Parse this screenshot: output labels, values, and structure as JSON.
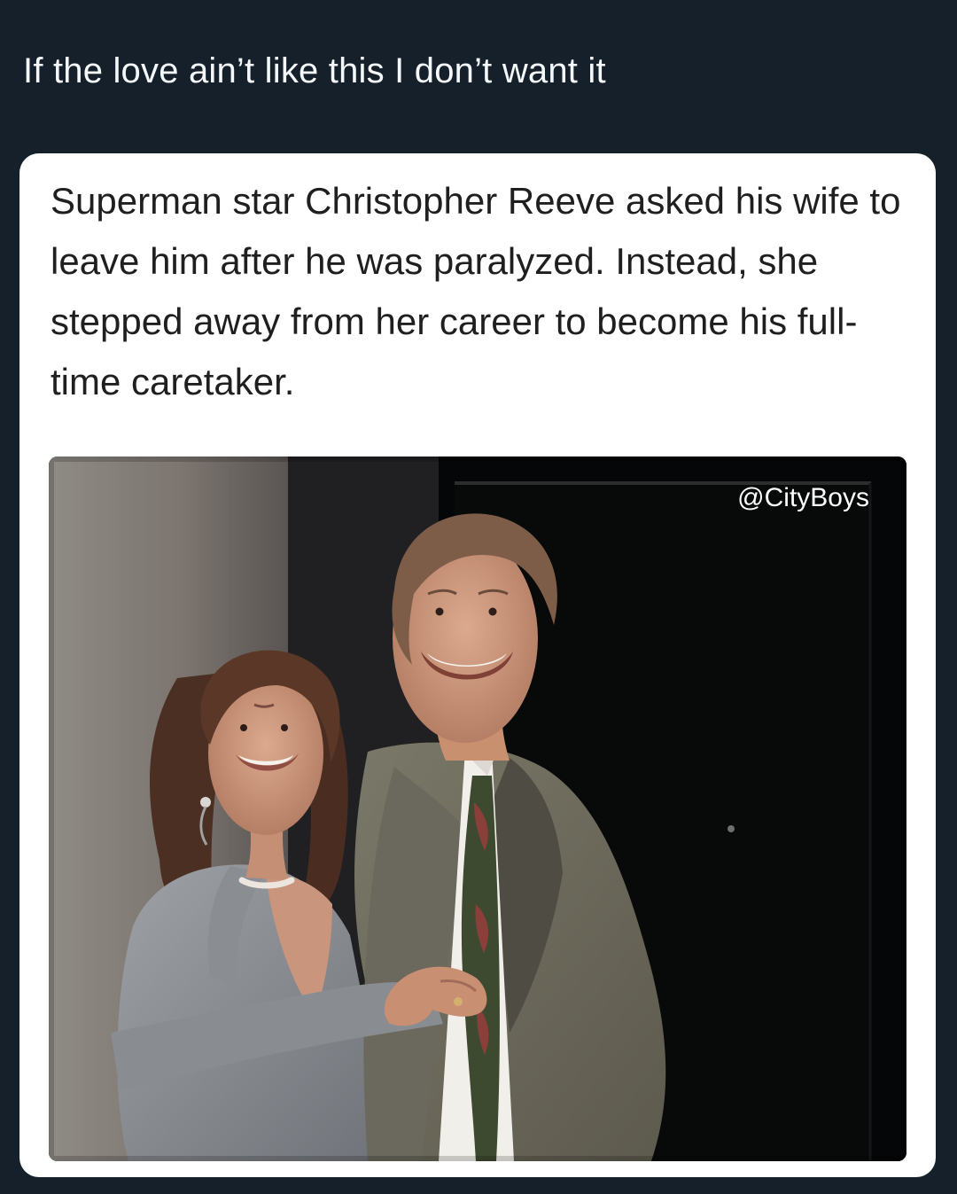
{
  "tweet": {
    "text": "If the love ain’t like this I don’t want it"
  },
  "card": {
    "caption": "Superman star Christopher Reeve asked his wife to leave him after he was paralyzed. Instead, she stepped away from her career to become his full-time caretaker.",
    "watermark": "@CityBoys"
  },
  "colors": {
    "background": "#15202b",
    "text": "#f5f8fa",
    "card": "#ffffff"
  }
}
